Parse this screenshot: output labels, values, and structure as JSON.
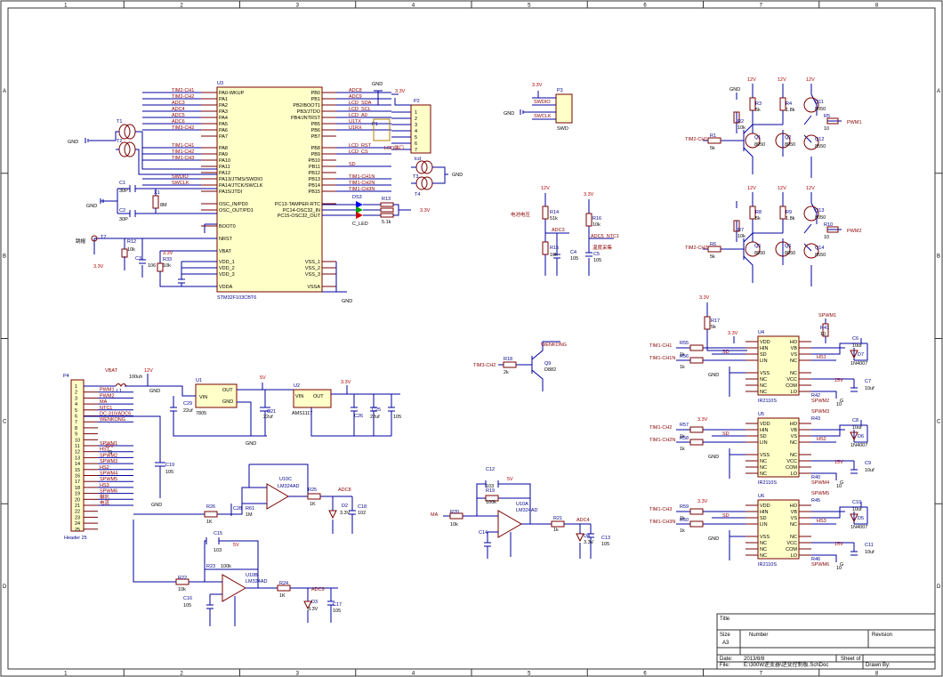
{
  "frame": {
    "cols": [
      "1",
      "2",
      "3",
      "4",
      "5",
      "6",
      "7",
      "8"
    ],
    "rows": [
      "A",
      "B",
      "C",
      "D"
    ]
  },
  "mcu": {
    "ref": "U3",
    "part": "STM32F103CBT6",
    "left_pins": [
      "PA0-WKUP",
      "PA1",
      "PA2",
      "PA3",
      "PA4",
      "PA5",
      "PA6",
      "PA7",
      "PA8",
      "PA9",
      "PA10",
      "PA11",
      "PA12",
      "PA13/JTMS/SWDIO",
      "PA14/JTCK/SWCLK",
      "PA15/JTDI",
      "OSC_IN/PD0",
      "OSC_OUT/PD1",
      "BOOT0",
      "NRST",
      "VBAT",
      "VDD_1",
      "VDD_2",
      "VDD_3",
      "VDDA"
    ],
    "right_pins": [
      "PB0",
      "PB1",
      "PB2/BOOT1",
      "PB3/JTDO",
      "PB4/JNTRST",
      "PB5",
      "PB6",
      "PB7",
      "PB8",
      "PB9",
      "PB10",
      "PB11",
      "PB12",
      "PB13",
      "PB14",
      "PB15",
      "PC13-TAMPER-RTC",
      "PC14-OSC32_IN",
      "PC15-OSC32_OUT",
      "VSS_1",
      "VSS_2",
      "VSS_3",
      "VSSA"
    ],
    "left_nets": [
      "TIM2-CH1",
      "TIM2-CH2",
      "ADC3",
      "ADC4",
      "ADC5",
      "ADC6",
      "TIM3-CH2",
      "",
      "TIM1-CH1",
      "TIM1-CH2",
      "TIM1-CH3",
      "",
      "",
      "SWDIO",
      "SWCLK"
    ],
    "right_nets": [
      "ADC8",
      "ADC9",
      "LCD_SDA",
      "LCD_SCL",
      "LCD_A0",
      "U1TX",
      "U1RX",
      "",
      "LCD_RST",
      "LCD_CS",
      "",
      "SD",
      "",
      "TIM1-CH1N",
      "TIM1-CH2N",
      "TIM1-CH3N"
    ]
  },
  "labels": {
    "gnd": "GND",
    "v33": "3.3V",
    "v12": "12V",
    "v5": "5V",
    "v15": "15V",
    "vbat": "VBAT",
    "t1": "T1",
    "t2": "T2",
    "t3": "T3",
    "t4": "T4",
    "t7": "T7",
    "jumper": "跳帽",
    "c1": "C1",
    "c2": "C2",
    "c1v": "30P",
    "c2v": "30P",
    "x1": "X1",
    "x1v": "8M",
    "r12": "R12",
    "r12v": "10k",
    "c3": "C3",
    "c3v": "106",
    "r33": "R33",
    "r33v": "10k",
    "ds3": "DS3",
    "cled": "C_LED",
    "r13": "R13",
    "r13v": "5.1k",
    "p2": "P2",
    "p2pins": [
      "1",
      "2",
      "3",
      "4",
      "5",
      "6",
      "7"
    ],
    "p1": "P1",
    "lcdport": "LCD端口",
    "lcd": "lcd",
    "p3": "P3",
    "swd": "SWD",
    "r14": "R14",
    "r14v": "51k",
    "r15": "R15",
    "r15v": "10k",
    "c4": "C4",
    "c4v": "105",
    "bat_volt": "电池电压",
    "adc3": "ADC3",
    "r16": "R16",
    "r16v": "10k",
    "c5": "C5",
    "c5v": "105",
    "ntc_net": "ADC5_NTC1",
    "temp": "温度采集",
    "q9": "Q9",
    "q9v": "D882",
    "r18": "R18",
    "r18v": "2k",
    "wenkong": "WENKONG",
    "tim3ch2": "TIM3-CH2",
    "p4": "P4",
    "header": "Header 25",
    "p4nets": [
      "PWM1",
      "PWM2",
      "MA",
      "NTC1",
      "DC-310/ADC6",
      "WENKONG",
      "",
      "",
      "",
      "SPWM1",
      "HS1",
      "SPWM2",
      "SPWM3",
      "HS2",
      "SPWM4",
      "SPWM5",
      "HS3",
      "SPWM6",
      "喇叭",
      "电流"
    ],
    "l1": "L1",
    "l1v": "100uh",
    "u1": "U1",
    "u1v": "7805",
    "u1vin": "VIN",
    "u1out": "OUT",
    "u1gnd": "GND",
    "c29": "C29",
    "c29v": "22uf",
    "c21": "C21",
    "c21v": "22uf",
    "c30": "C30",
    "c30v": "105",
    "u2": "U2",
    "u2v": "AMS1117",
    "c26": "C26",
    "c25": "C25",
    "c25v": "22uf",
    "c19": "C19",
    "c19v": "105",
    "c20": "C20",
    "u10c": "U10C",
    "lm324": "LM324AD",
    "r26": "R26",
    "r26v": "1K",
    "r61": "R61",
    "r61v": "1M",
    "c28": "C28",
    "r25": "R25",
    "r25v": "1K",
    "adc8": "ADC8",
    "d2": "D2",
    "d2v": "3.3V",
    "c18": "C18",
    "c18v": "102",
    "c15": "C15",
    "c15v": "103",
    "r23": "R23",
    "r23v": "100k",
    "u10b": "U10B",
    "r22": "R22",
    "r22v": "10k",
    "c16": "C16",
    "c16v": "105",
    "r24": "R24",
    "r24v": "1K",
    "adc9": "ADC9",
    "d3": "D3",
    "d3v": "3.3V",
    "c17": "C17",
    "c17v": "105",
    "c12": "C12",
    "c12v": "103",
    "r19": "R19",
    "r19v": "100k",
    "u10a": "U10A",
    "ma": "MA",
    "r20": "R20",
    "r20v": "10k",
    "c14": "C14",
    "r21": "R21",
    "r21v": "1k",
    "adc4": "ADC4",
    "d4": "D4",
    "d4v": "3.3V",
    "c13": "C13",
    "c13v": "105",
    "r2": "R2",
    "r3": "R3",
    "r4": "R4",
    "r5": "R5",
    "r1": "R1",
    "q1": "Q1",
    "q2": "Q2",
    "q11": "Q11",
    "q12": "Q12",
    "v10k": "10k",
    "v5k": "5k",
    "v10": "10",
    "v18k": "1.8k",
    "s8050": "8050",
    "s8550": "8550",
    "tim2ch1": "TIM2-CH1",
    "pwm1": "PWM1",
    "r6": "R6",
    "r7": "R7",
    "r8": "R8",
    "r9": "R9",
    "r10": "R10",
    "q5": "Q5",
    "q6": "Q6",
    "q13": "Q13",
    "q14": "Q14",
    "tim2ch2": "TIM2-CH2",
    "pwm2": "PWM2",
    "r17": "R17",
    "r17v": "5k",
    "spwm1": "SPWM1",
    "r41": "R41",
    "u4": "U4",
    "u5": "U5",
    "u6": "U6",
    "ir2110": "IR2110S",
    "ir_left": [
      "VDD",
      "HIN",
      "SD",
      "LIN",
      "VSS",
      "NC",
      "NC",
      "NC"
    ],
    "ir_right": [
      "HO",
      "VB",
      "VS",
      "NC",
      "NC",
      "VCC",
      "COM",
      "LO"
    ],
    "tim1ch1": "TIM1-CH1",
    "tim1ch1n": "TIM1-CH1N",
    "tim1ch2": "TIM1-CH2",
    "tim1ch2n": "TIM1-CH2N",
    "tim1ch3": "TIM1-CH3",
    "tim1ch3n": "TIM1-CH3N",
    "sd": "SD",
    "hs1": "HS1",
    "hs2": "HS2",
    "hs3": "HS3",
    "spwm2": "SPWM2",
    "spwm3": "SPWM3",
    "spwm4": "SPWM4",
    "spwm5": "SPWM5",
    "spwm6": "SPWM6",
    "in4007": "1N4007",
    "c10uf": "10uf",
    "r55": "R55",
    "r56": "R56",
    "r57": "R57",
    "r58": "R58",
    "r59": "R59",
    "r60": "R60",
    "v1k": "1k",
    "r42": "R42",
    "r43": "R43",
    "r44": "R44",
    "r45": "R45",
    "r46": "R46",
    "r40": "R40",
    "c6": "C6",
    "c7": "C7",
    "c8": "C8",
    "c9": "C9",
    "c10": "C10",
    "c11": "C11",
    "d7": "D7",
    "d6": "D6",
    "d5": "D5",
    "g": "G"
  },
  "title_block": {
    "title_label": "Title",
    "size_label": "Size",
    "size": "A3",
    "number_label": "Number",
    "revision_label": "Revision",
    "date_label": "Date:",
    "date": "2013/8/8",
    "file_label": "File:",
    "file": "E:\\300W逆变器\\逆变控制板.SchDoc",
    "sheet_label": "Sheet of",
    "drawn_label": "Drawn By:"
  }
}
